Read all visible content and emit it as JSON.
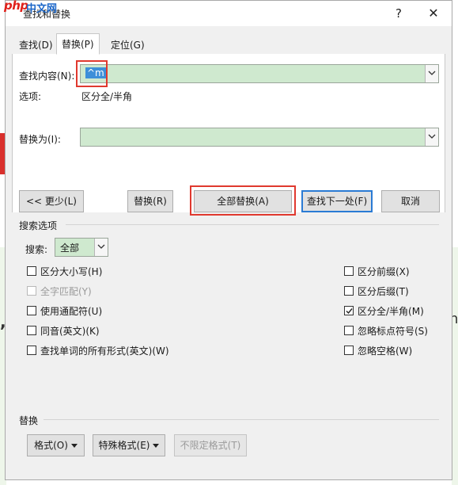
{
  "window": {
    "title": "查找和替换",
    "logo_text": "php",
    "logo_text_2": "中文网",
    "help_label": "?",
    "close_label": "✕"
  },
  "tabs": [
    {
      "label": "查找(D)",
      "active": false
    },
    {
      "label": "替换(P)",
      "active": true
    },
    {
      "label": "定位(G)",
      "active": false
    }
  ],
  "find": {
    "label": "查找内容(N):",
    "value": "^m",
    "options_label": "选项:",
    "options_value": "区分全/半角"
  },
  "replace": {
    "label": "替换为(I):",
    "value": ""
  },
  "buttons": {
    "less": "<< 更少(L)",
    "replace": "替换(R)",
    "replace_all": "全部替换(A)",
    "find_next": "查找下一处(F)",
    "cancel": "取消"
  },
  "search_options": {
    "title": "搜索选项",
    "search_label": "搜索:",
    "search_value": "全部",
    "left": [
      {
        "label": "区分大小写(H)",
        "checked": false,
        "disabled": false
      },
      {
        "label": "全字匹配(Y)",
        "checked": false,
        "disabled": true
      },
      {
        "label": "使用通配符(U)",
        "checked": false,
        "disabled": false
      },
      {
        "label": "同音(英文)(K)",
        "checked": false,
        "disabled": false
      },
      {
        "label": "查找单词的所有形式(英文)(W)",
        "checked": false,
        "disabled": false
      }
    ],
    "right": [
      {
        "label": "区分前缀(X)",
        "checked": false,
        "disabled": false
      },
      {
        "label": "区分后缀(T)",
        "checked": false,
        "disabled": false
      },
      {
        "label": "区分全/半角(M)",
        "checked": true,
        "disabled": false
      },
      {
        "label": "忽略标点符号(S)",
        "checked": false,
        "disabled": false
      },
      {
        "label": "忽略空格(W)",
        "checked": false,
        "disabled": false
      }
    ]
  },
  "replace_section": {
    "title": "替换",
    "format": "格式(O)",
    "special": "特殊格式(E)",
    "no_format": "不限定格式(T)"
  },
  "colors": {
    "accent_blue": "#2a7bd4",
    "highlight_red": "#e0392f",
    "field_green": "#cfe9cf"
  }
}
